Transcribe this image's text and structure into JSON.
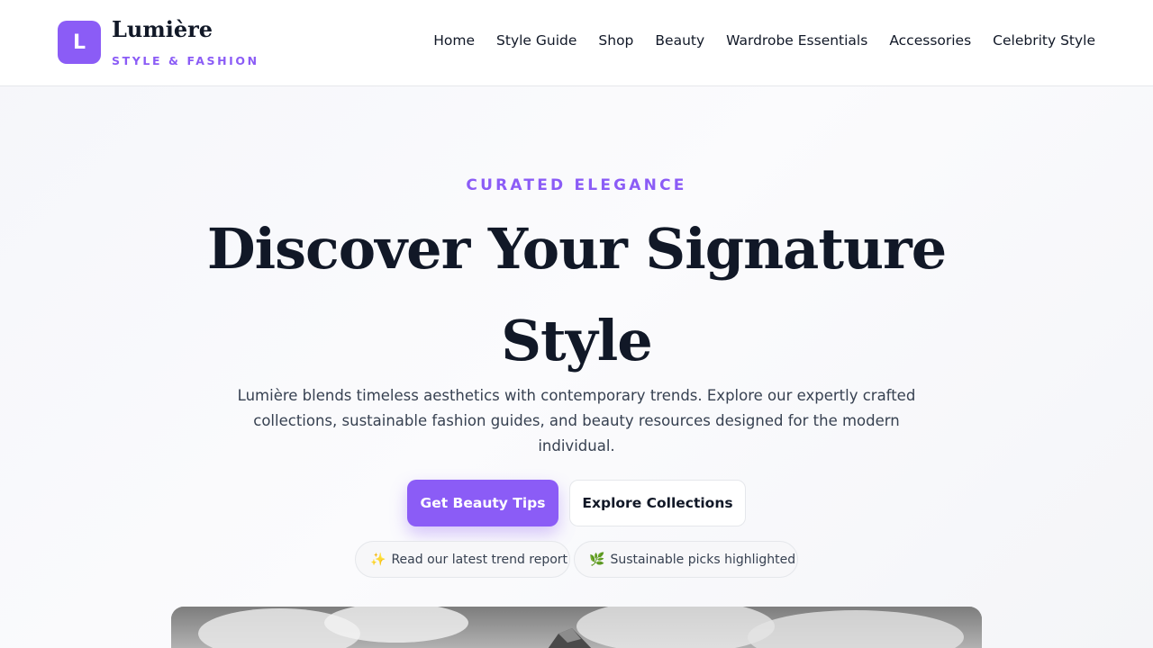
{
  "brand": {
    "logo_letter": "L",
    "name": "Lumière",
    "tagline": "STYLE & FASHION"
  },
  "nav": {
    "items": [
      {
        "label": "Home"
      },
      {
        "label": "Style Guide"
      },
      {
        "label": "Shop"
      },
      {
        "label": "Beauty"
      },
      {
        "label": "Wardrobe Essentials"
      },
      {
        "label": "Accessories"
      },
      {
        "label": "Celebrity Style"
      }
    ]
  },
  "hero": {
    "eyebrow": "CURATED ELEGANCE",
    "headline": "Discover Your Signature Style",
    "lede": "Lumière blends timeless aesthetics with contemporary trends. Explore our expertly crafted collections, sustainable fashion guides, and beauty resources designed for the modern individual.",
    "primary_cta": "Get Beauty Tips",
    "secondary_cta": "Explore Collections",
    "chips": [
      {
        "icon": "sparkles-icon",
        "glyph": "✨",
        "label": "Read our latest trend report"
      },
      {
        "icon": "leaf-icon",
        "glyph": "🌿",
        "label": "Sustainable picks highlighted"
      }
    ]
  },
  "colors": {
    "accent": "#8b5cf6",
    "text": "#111827",
    "muted": "#374151"
  }
}
